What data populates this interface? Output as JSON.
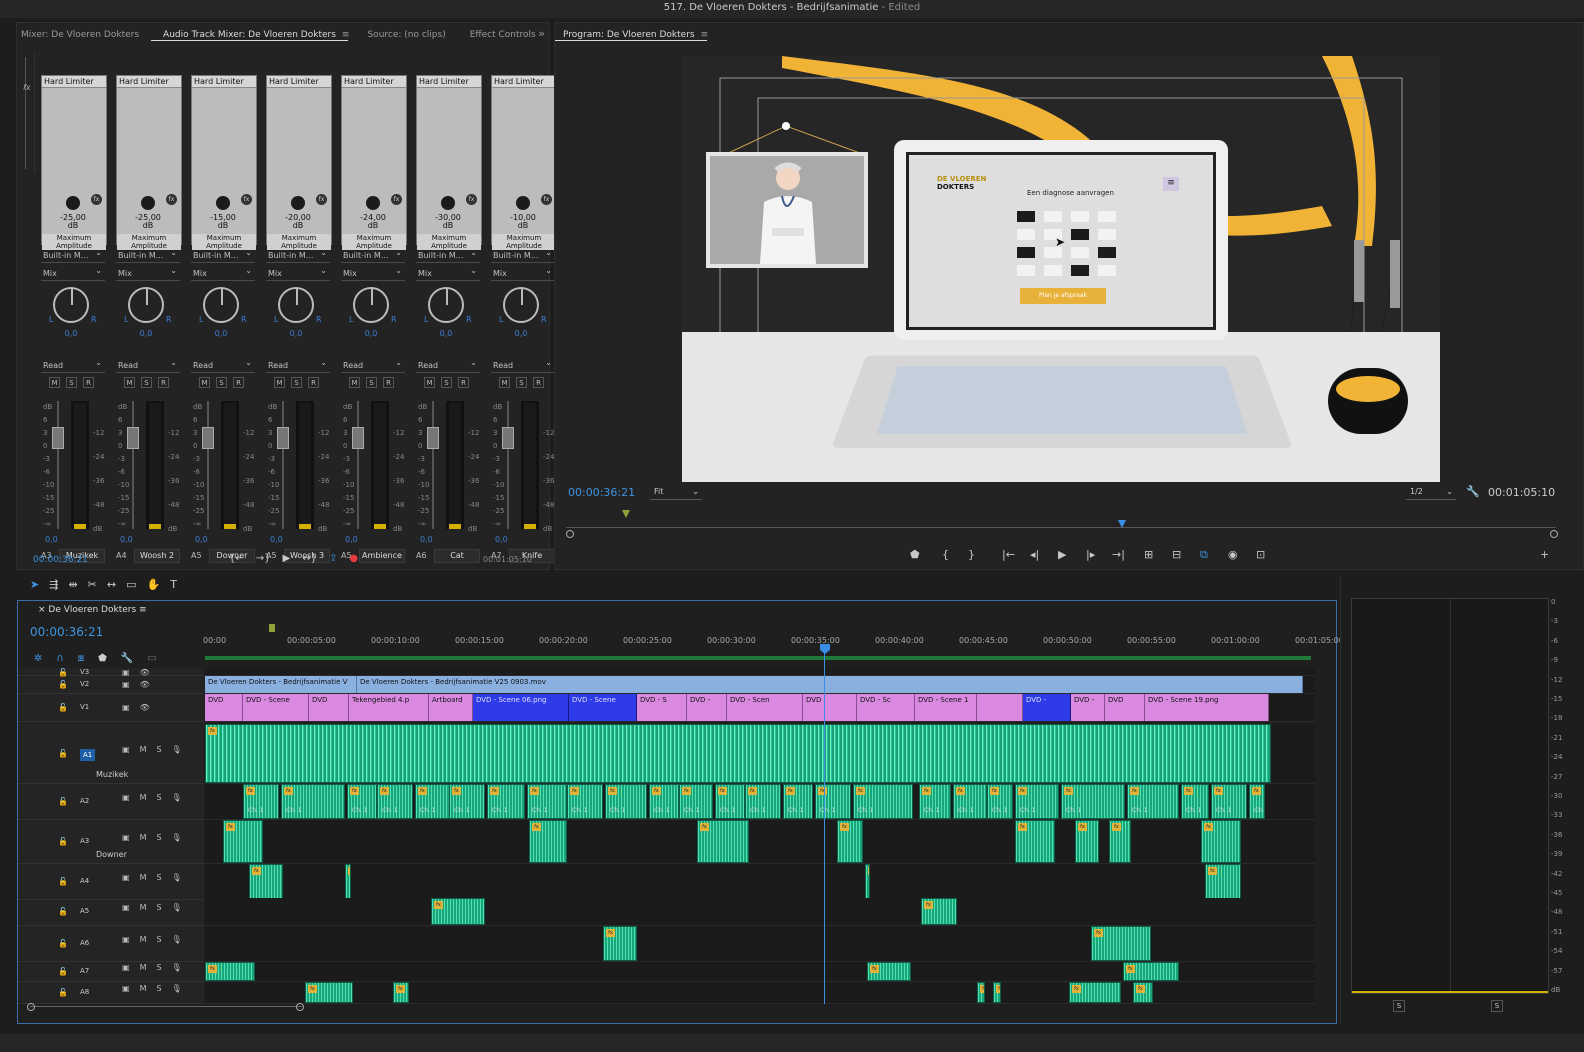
{
  "window": {
    "title": "517. De Vloeren Dokters - Bedrijfsanimatie",
    "edited": "- Edited"
  },
  "top_left_panel": {
    "tabs": [
      "Mixer: De Vloeren Dokters",
      "Audio Track Mixer: De Vloeren Dokters",
      "Source: (no clips)",
      "Effect Controls"
    ],
    "menu_icon": "hamburger-icon",
    "more_icon": "double-chevron-right-icon",
    "current_time": "00:00:36:21",
    "end_time": "00:01:05:10"
  },
  "mixer": {
    "strips": [
      {
        "effect": "Hard Limiter",
        "gain": "-25,00",
        "unit": "dB",
        "param": "Maximum Amplitude",
        "send": "Built-in M...",
        "mix": "Mix",
        "pan_l": "L",
        "pan_r": "R",
        "pan": "0,0",
        "mode": "Read",
        "volume": "0,0",
        "track": "A3",
        "name": "Muzikek"
      },
      {
        "effect": "Hard Limiter",
        "gain": "-25,00",
        "unit": "dB",
        "param": "Maximum Amplitude",
        "send": "Built-in M...",
        "mix": "Mix",
        "pan_l": "L",
        "pan_r": "R",
        "pan": "0,0",
        "mode": "Read",
        "volume": "0,0",
        "track": "A4",
        "name": "Woosh 2"
      },
      {
        "effect": "Hard Limiter",
        "gain": "-15,00",
        "unit": "dB",
        "param": "Maximum Amplitude",
        "send": "Built-in M...",
        "mix": "Mix",
        "pan_l": "L",
        "pan_r": "R",
        "pan": "0,0",
        "mode": "Read",
        "volume": "0,0",
        "track": "A5",
        "name": "Downer"
      },
      {
        "effect": "Hard Limiter",
        "gain": "-20,00",
        "unit": "dB",
        "param": "Maximum Amplitude",
        "send": "Built-in M...",
        "mix": "Mix",
        "pan_l": "L",
        "pan_r": "R",
        "pan": "0,0",
        "mode": "Read",
        "volume": "0,0",
        "track": "A5",
        "name": "Woosh 3"
      },
      {
        "effect": "Hard Limiter",
        "gain": "-24,00",
        "unit": "dB",
        "param": "Maximum Amplitude",
        "send": "Built-in M...",
        "mix": "Mix",
        "pan_l": "L",
        "pan_r": "R",
        "pan": "0,0",
        "mode": "Read",
        "volume": "0,0",
        "track": "A5",
        "name": "Ambience"
      },
      {
        "effect": "Hard Limiter",
        "gain": "-30,00",
        "unit": "dB",
        "param": "Maximum Amplitude",
        "send": "Built-in M...",
        "mix": "Mix",
        "pan_l": "L",
        "pan_r": "R",
        "pan": "0,0",
        "mode": "Read",
        "volume": "0,0",
        "track": "A6",
        "name": "Cat"
      },
      {
        "effect": "Hard Limiter",
        "gain": "-10,00",
        "unit": "dB",
        "param": "Maximum Amplitude",
        "send": "Built-in M...",
        "mix": "Mix",
        "pan_l": "L",
        "pan_r": "R",
        "pan": "0,0",
        "mode": "Read",
        "volume": "0,0",
        "track": "A7",
        "name": "Knife"
      }
    ],
    "db_label": "dB",
    "db_left": [
      "6",
      "3",
      "0",
      "-3",
      "-6",
      "-10",
      "-15",
      "-25",
      "-∞"
    ],
    "db_right": [
      "-12",
      "-24",
      "-36",
      "-48"
    ],
    "msr": [
      "M",
      "S",
      "R"
    ],
    "fx_badge": "fx"
  },
  "program": {
    "title": "Program: De Vloeren Dokters",
    "current_time": "00:00:36:21",
    "fit": "Fit",
    "resolution": "1/2",
    "duration": "00:01:05:10",
    "screen": {
      "logo_line1": "DE VLOEREN",
      "logo_line2": "DOKTERS",
      "heading": "Een diagnose aanvragen",
      "cta": "Plan je afspraak"
    },
    "controls": [
      "marker-icon",
      "mark-in-icon",
      "mark-out-icon",
      "go-to-in-icon",
      "step-back-icon",
      "play-icon",
      "step-forward-icon",
      "go-to-out-icon",
      "lift-icon",
      "extract-icon",
      "comparison-icon",
      "export-frame-icon",
      "multicam-icon",
      "add-button-icon"
    ]
  },
  "timeline": {
    "sequence": "De Vloeren Dokters",
    "current_time": "00:00:36:21",
    "ruler": [
      "00:00",
      "00:00:05:00",
      "00:00:10:00",
      "00:00:15:00",
      "00:00:20:00",
      "00:00:25:00",
      "00:00:30:00",
      "00:00:35:00",
      "00:00:40:00",
      "00:00:45:00",
      "00:00:50:00",
      "00:00:55:00",
      "00:01:00:00",
      "00:01:05:00"
    ],
    "tools": [
      "selection-tool-icon",
      "track-select-tool-icon",
      "ripple-edit-tool-icon",
      "razor-tool-icon",
      "slip-tool-icon",
      "rectangle-tool-icon",
      "hand-tool-icon",
      "type-tool-icon"
    ],
    "tracks": [
      {
        "id": "V3",
        "name": ""
      },
      {
        "id": "V2",
        "name": ""
      },
      {
        "id": "V1",
        "name": ""
      },
      {
        "id": "A1",
        "name": "Muzikek"
      },
      {
        "id": "A2",
        "name": ""
      },
      {
        "id": "A3",
        "name": "Downer"
      },
      {
        "id": "A4",
        "name": ""
      },
      {
        "id": "A5",
        "name": ""
      },
      {
        "id": "A6",
        "name": ""
      },
      {
        "id": "A7",
        "name": ""
      },
      {
        "id": "A8",
        "name": ""
      }
    ],
    "track_buttons": [
      "M",
      "S"
    ],
    "v2_clips": [
      "De Vloeren Dokters - Bedrijfsanimatie V",
      "De Vloeren Dokters - Bedrijfsanimatie V25 0903.mov"
    ],
    "v1_clips": [
      "DVD",
      "DVD - Scene",
      "DVD",
      "Tekengebied 4.p",
      "Artboard",
      "DVD - Scene 06.png",
      "DVD - Scene",
      "DVD - S",
      "DVD -",
      "DVD - Scen",
      "DVD",
      "",
      "DVD - Sc",
      "DVD - Scene 1",
      "",
      "DVD -",
      "DVD -",
      "DVD",
      "DVD - Scene 19.png"
    ],
    "channel_label": "Ch. 1"
  },
  "audio_meter": {
    "scale": [
      "0",
      "-3",
      "-6",
      "-9",
      "-12",
      "-15",
      "-18",
      "-21",
      "-24",
      "-27",
      "-30",
      "-33",
      "-36",
      "-39",
      "-42",
      "-45",
      "-48",
      "-51",
      "-54",
      "-57",
      "dB"
    ],
    "solo": [
      "S",
      "S"
    ]
  },
  "colors": {
    "accent_blue": "#3d94e0",
    "audio_clip": "#1ba37a",
    "video_clip_pink": "#d98ae0",
    "video_clip_blue": "#2f3be8",
    "video_clip_light": "#8ab0e0",
    "brand_yellow": "#f0b336"
  }
}
